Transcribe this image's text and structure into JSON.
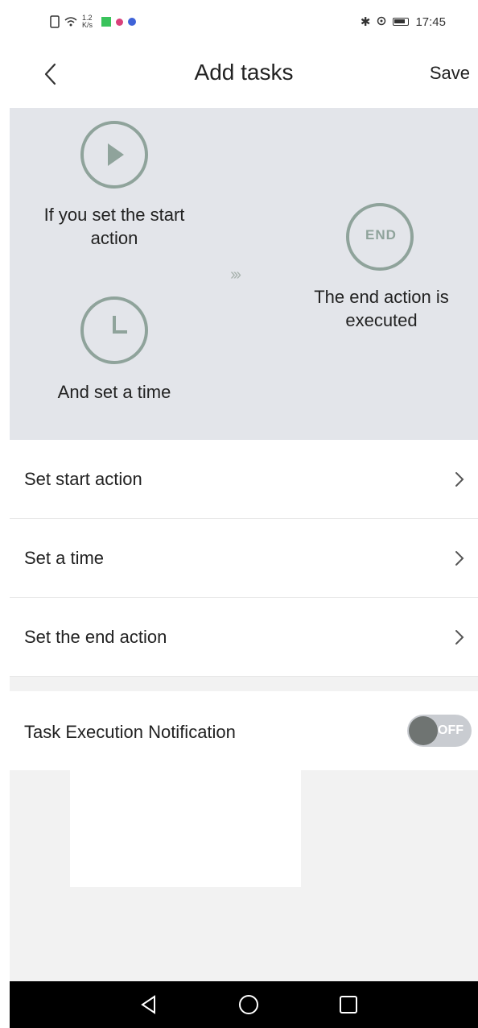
{
  "status_bar": {
    "net_speed": "1.2 K/s",
    "time": "17:45",
    "icons": [
      "sim-icon",
      "wifi-icon",
      "app-icon",
      "bluetooth-icon",
      "location-icon",
      "battery-icon"
    ]
  },
  "header": {
    "title": "Add tasks",
    "save_label": "Save",
    "back_icon": "chevron-left-icon"
  },
  "illustration": {
    "start_label": "If you set the start action",
    "time_label": "And set a time",
    "end_label": "The end action is executed",
    "end_badge": "END",
    "arrows": "›››",
    "accent_color": "#8fa39b"
  },
  "list": {
    "items": [
      {
        "label": "Set start action"
      },
      {
        "label": "Set a time"
      },
      {
        "label": "Set the end action"
      }
    ]
  },
  "notification": {
    "label": "Task Execution Notification",
    "toggle_state": "OFF"
  },
  "nav_bar": {
    "buttons": [
      "back-triangle-icon",
      "home-circle-icon",
      "recents-square-icon"
    ]
  }
}
